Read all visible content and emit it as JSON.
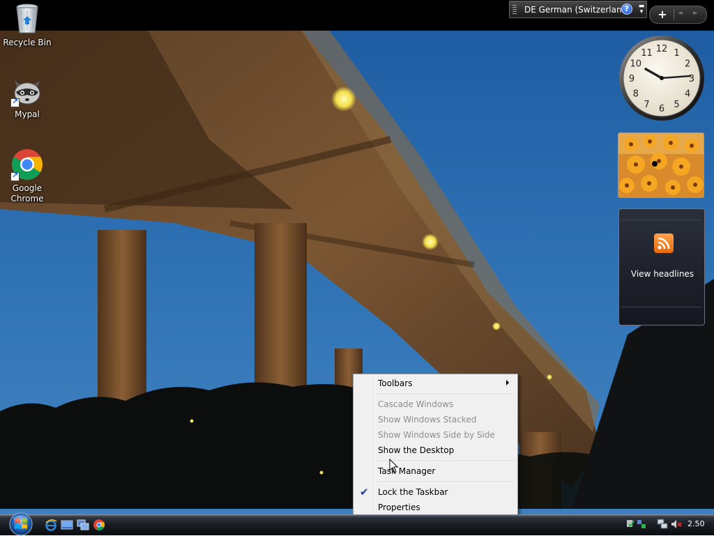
{
  "language_bar": {
    "label": "DE German (Switzerland)",
    "help": "?"
  },
  "sidebar_controls": {
    "add": "+",
    "prev": "◄",
    "next": "►"
  },
  "desktop_icons": [
    {
      "label": "Recycle Bin",
      "icon": "recycle-bin-icon"
    },
    {
      "label": "Mypal",
      "icon": "raccoon-icon"
    },
    {
      "label_line1": "Google",
      "label_line2": "Chrome",
      "icon": "chrome-icon"
    }
  ],
  "clock_gadget": {
    "numbers": [
      "12",
      "1",
      "2",
      "3",
      "4",
      "5",
      "6",
      "7",
      "8",
      "9",
      "10",
      "11"
    ]
  },
  "feed_gadget": {
    "label": "View headlines"
  },
  "context_menu": {
    "items": [
      {
        "label": "Toolbars",
        "enabled": true,
        "submenu": true
      },
      {
        "label": "Cascade Windows",
        "enabled": false
      },
      {
        "label": "Show Windows Stacked",
        "enabled": false
      },
      {
        "label": "Show Windows Side by Side",
        "enabled": false
      },
      {
        "label": "Show the Desktop",
        "enabled": true
      },
      {
        "label": "Task Manager",
        "enabled": true
      },
      {
        "label": "Lock the Taskbar",
        "enabled": true,
        "checked": true
      },
      {
        "label": "Properties",
        "enabled": true
      }
    ]
  },
  "taskbar": {
    "quick_launch": [
      "internet-explorer-icon",
      "show-desktop-icon",
      "switch-windows-icon",
      "chrome-icon"
    ],
    "tray_icons": [
      "windows-defender-icon",
      "network-icon",
      "volume-muted-icon"
    ],
    "time": "2.50"
  },
  "colors": {
    "taskbar": "#181b21",
    "menu_background": "#f0f0f0",
    "menu_disabled_text": "#8d8d8d",
    "sky": "#2d6fb0"
  }
}
